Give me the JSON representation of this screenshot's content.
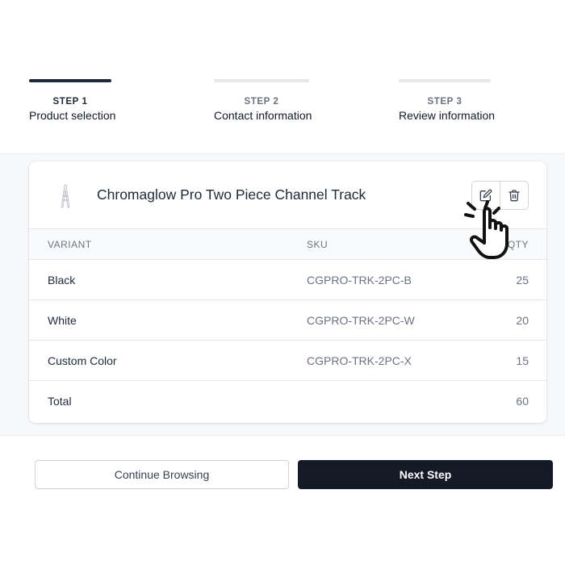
{
  "stepper": {
    "steps": [
      {
        "number": "STEP 1",
        "label": "Product selection",
        "active": true
      },
      {
        "number": "STEP 2",
        "label": "Contact information",
        "active": false
      },
      {
        "number": "STEP 3",
        "label": "Review information",
        "active": false
      }
    ]
  },
  "product": {
    "name": "Chromaglow Pro Two Piece Channel Track",
    "thumbnail_icon": "channel-track-thumbnail",
    "actions": {
      "edit_icon": "edit-icon",
      "delete_icon": "trash-icon"
    }
  },
  "table": {
    "headers": {
      "variant": "VARIANT",
      "sku": "SKU",
      "qty": "QTY"
    },
    "rows": [
      {
        "variant": "Black",
        "sku": "CGPRO-TRK-2PC-B",
        "qty": "25"
      },
      {
        "variant": "White",
        "sku": "CGPRO-TRK-2PC-W",
        "qty": "20"
      },
      {
        "variant": "Custom Color",
        "sku": "CGPRO-TRK-2PC-X",
        "qty": "15"
      }
    ],
    "total": {
      "label": "Total",
      "qty": "60"
    }
  },
  "footer": {
    "continue_label": "Continue Browsing",
    "next_label": "Next Step"
  },
  "colors": {
    "primary": "#141a26",
    "active_step": "#1f2937",
    "inactive_step": "#e5e7eb",
    "content_bg": "#f7f8fa"
  },
  "cursor_icon": "hand-pointer-click-icon"
}
